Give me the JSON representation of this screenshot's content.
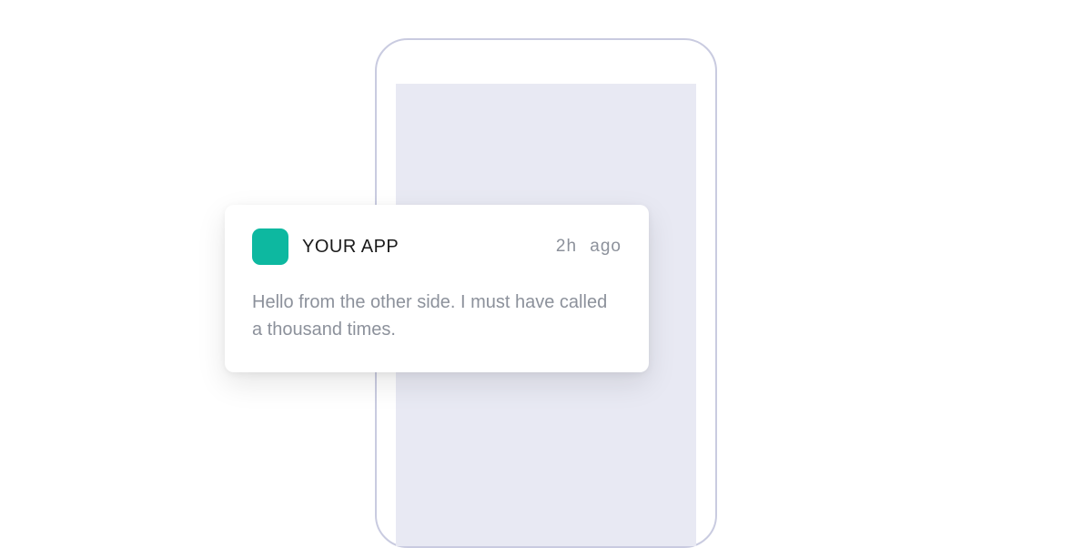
{
  "notification": {
    "app_name": "YOUR APP",
    "timestamp": "2h ago",
    "message": "Hello from the other side. I must have called a thousand times.",
    "icon_color": "#0db8a0"
  }
}
